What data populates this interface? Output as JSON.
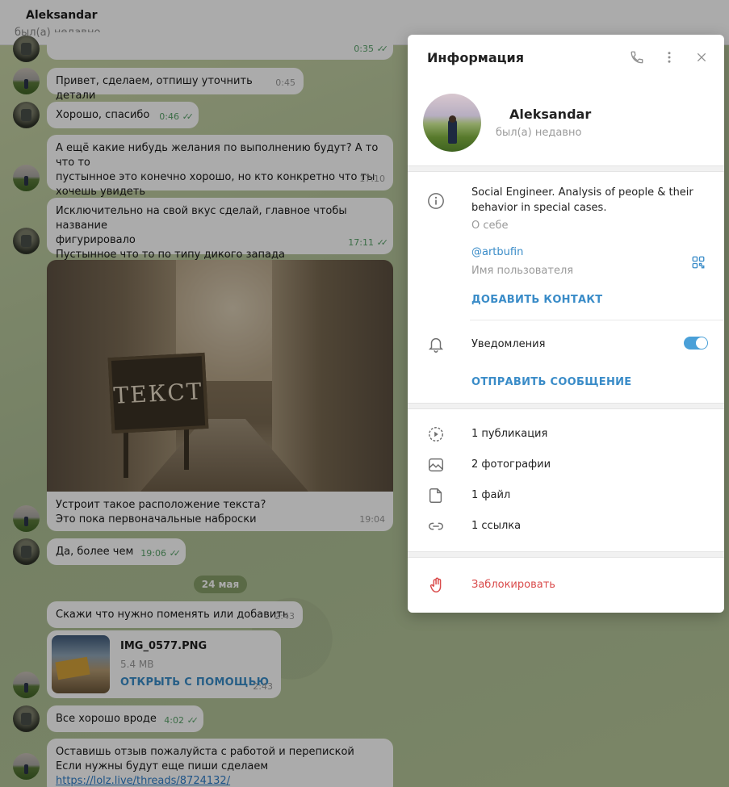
{
  "chat_header": {
    "title": "Aleksandar",
    "status": "был(а) недавно"
  },
  "messages": [
    {
      "time": "0:35",
      "read": true
    },
    {
      "text": "Привет, сделаем, отпишу уточнить детали",
      "time": "0:45",
      "read": false
    },
    {
      "text": "Хорошо, спасибо",
      "time": "0:46",
      "read": true
    },
    {
      "lines": [
        "А ещё какие нибудь желания по выполнению будут? А то что то",
        "пустынное это конечно хорошо, но кто конкретно что ты",
        "хочешь увидеть"
      ],
      "time": "17:10",
      "read": false
    },
    {
      "lines": [
        "Исключительно на свой вкус сделай, главное чтобы название",
        "фигурировало",
        "Пустынное что то по типу дикого запада"
      ],
      "time": "17:11",
      "read": true
    },
    {
      "photo_text": "ТЕКСТ",
      "lines": [
        "Устроит такое расположение текста?",
        "Это пока первоначальные наброски"
      ],
      "time": "19:04",
      "read": false
    },
    {
      "text": "Да, более чем",
      "time": "19:06",
      "read": true
    },
    {
      "text": "Скажи что нужно поменять или добавить",
      "time": "2:43",
      "read": false
    },
    {
      "file_name": "IMG_0577.PNG",
      "file_size": "5.4 MB",
      "file_action": "ОТКРЫТЬ С ПОМОЩЬЮ",
      "time": "2:43",
      "read": false
    },
    {
      "text": "Все хорошо вроде",
      "time": "4:02",
      "read": true
    },
    {
      "lines": [
        "Оставишь отзыв пожалуйста с работой и перепиской",
        "Если нужны будут еще пиши сделаем"
      ],
      "link": "https://lolz.live/threads/8724132/"
    }
  ],
  "date_divider": "24 мая",
  "panel": {
    "title": "Информация",
    "name": "Aleksandar",
    "status": "был(а) недавно",
    "bio": "Social Engineer. Analysis of people & their behavior in special cases.",
    "bio_label": "О себе",
    "username": "@artbufin",
    "username_label": "Имя пользователя",
    "add_contact": "ДОБАВИТЬ КОНТАКТ",
    "notifications_label": "Уведомления",
    "notifications_on": true,
    "send_message": "ОТПРАВИТЬ СООБЩЕНИЕ",
    "media": [
      {
        "icon": "publication-icon",
        "label": "1 публикация"
      },
      {
        "icon": "photo-icon",
        "label": "2 фотографии"
      },
      {
        "icon": "file-icon",
        "label": "1 файл"
      },
      {
        "icon": "link-icon",
        "label": "1 ссылка"
      }
    ],
    "block": "Заблокировать",
    "colors": {
      "accent": "#3a8cc8",
      "danger": "#d94a4a",
      "toggle": "#4aa0d8"
    }
  }
}
